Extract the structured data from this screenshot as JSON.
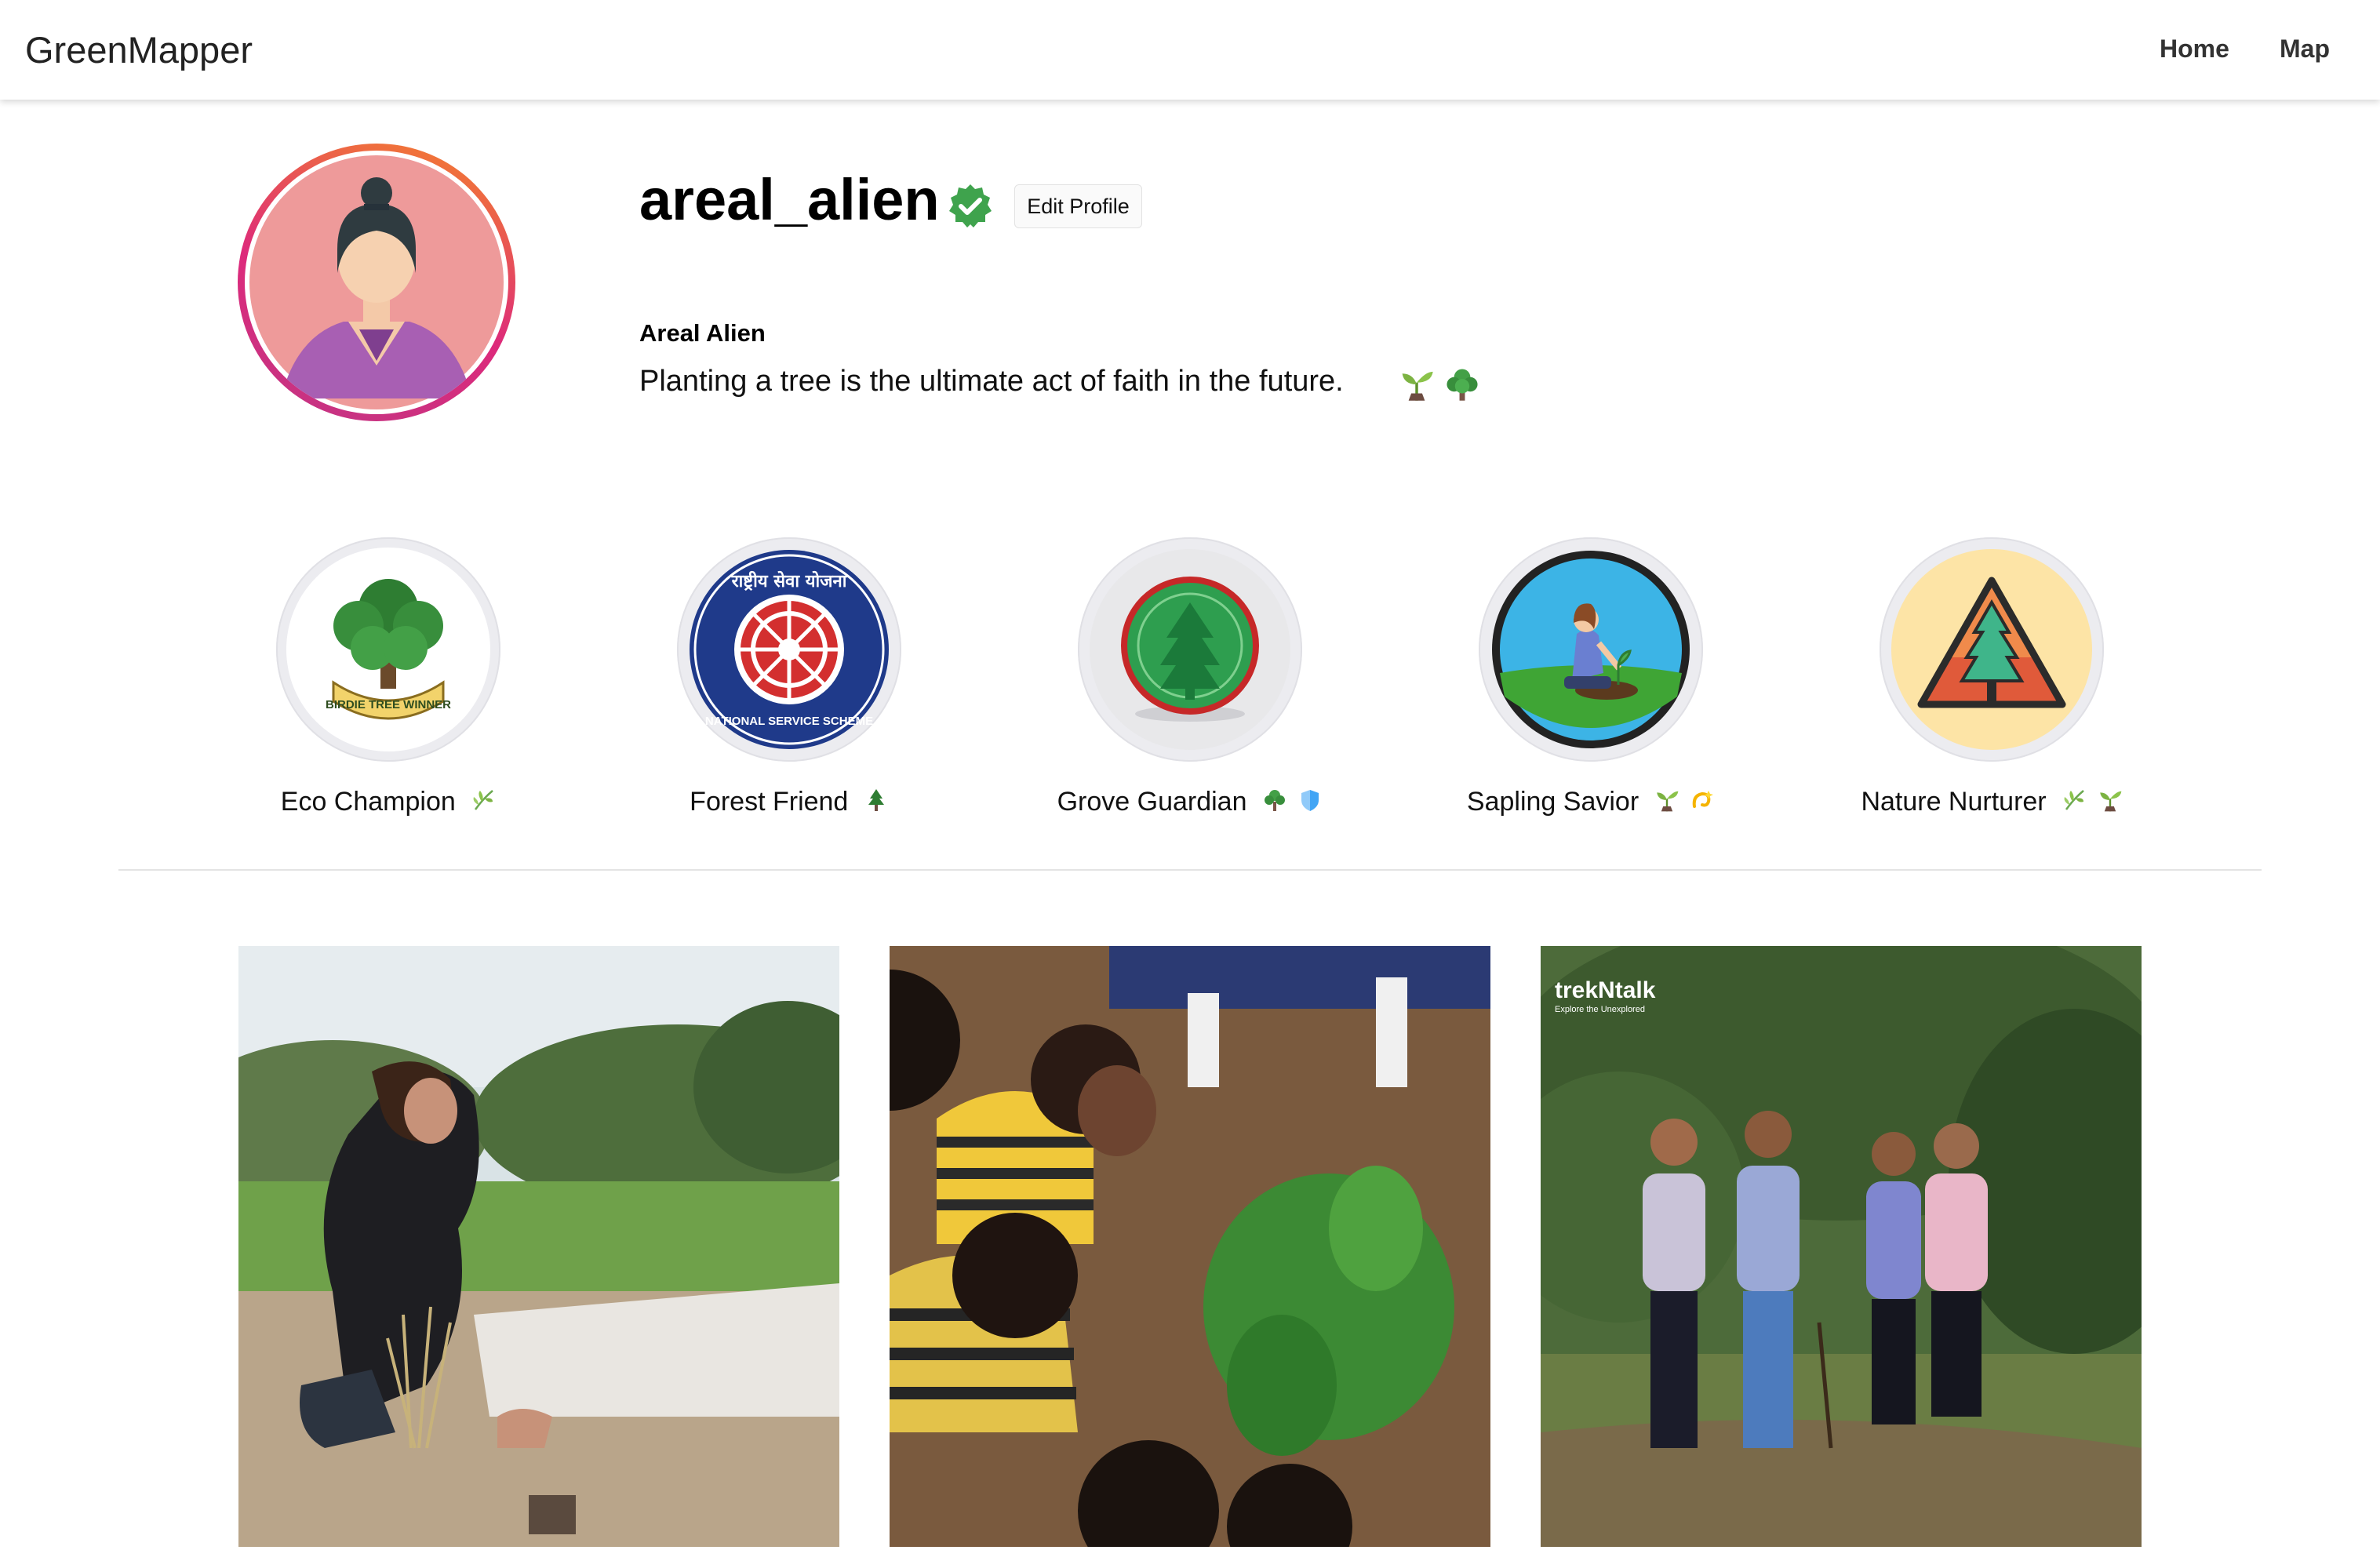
{
  "app": {
    "title": "GreenMapper"
  },
  "nav": {
    "home_label": "Home",
    "map_label": "Map"
  },
  "profile": {
    "username": "areal_alien",
    "verified": true,
    "edit_label": "Edit Profile",
    "display_name": "Areal Alien",
    "bio": "Planting a tree is the ultimate act of faith in the future.",
    "bio_icons": [
      "seedling-icon",
      "tree-icon"
    ]
  },
  "badges": [
    {
      "label": "Eco Champion",
      "image": "birdie-tree-winner-badge",
      "icons": [
        "herb-icon"
      ]
    },
    {
      "label": "Forest Friend",
      "image": "national-service-scheme-badge",
      "icons": [
        "evergreen-icon"
      ]
    },
    {
      "label": "Grove Guardian",
      "image": "pine-tree-seal-badge",
      "icons": [
        "tree-icon",
        "shield-icon"
      ]
    },
    {
      "label": "Sapling Savior",
      "image": "woman-planting-badge",
      "icons": [
        "seedling-icon",
        "dizzy-icon"
      ]
    },
    {
      "label": "Nature Nurturer",
      "image": "pine-triangle-badge",
      "icons": [
        "herb-icon",
        "seedling-icon"
      ]
    }
  ],
  "badge_images": {
    "birdie_text": "BIRDIE TREE WINNER",
    "nss_top": "राष्ट्रीय सेवा योजना",
    "nss_bottom": "NATIONAL SERVICE SCHEME"
  },
  "posts": [
    {
      "image": "girl-planting-grass-photo"
    },
    {
      "image": "children-planting-sapling-photo"
    },
    {
      "image": "group-tree-planting-photo",
      "watermark_title": "trekNtalk",
      "watermark_sub": "Explore the Unexplored"
    }
  ],
  "colors": {
    "verified": "#3fa34d",
    "avatar_ring_start": "#f58529",
    "avatar_ring_end": "#c13584"
  }
}
